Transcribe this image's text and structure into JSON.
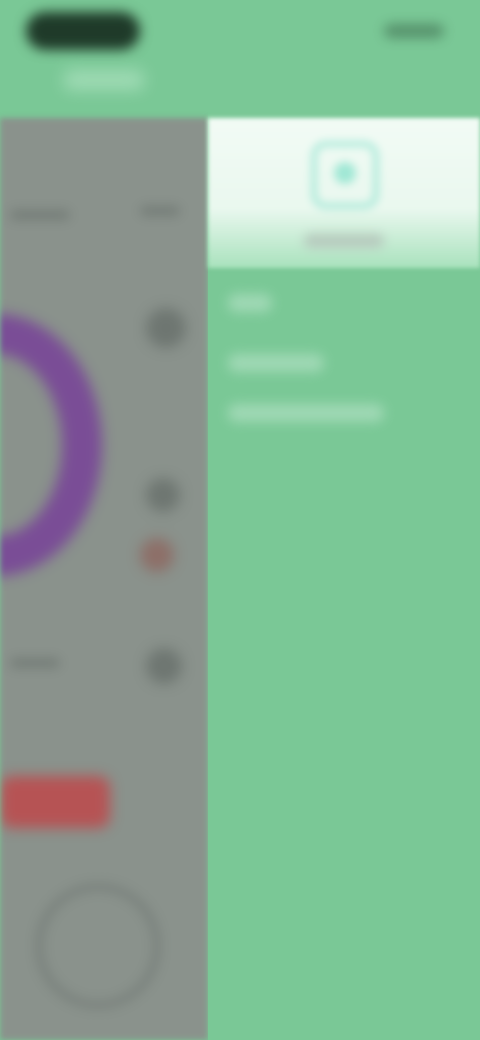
{
  "status_bar": {
    "time": "",
    "indicators": ""
  },
  "drawer": {
    "user_name": "",
    "menu_items": [
      {
        "label": ""
      },
      {
        "label": ""
      },
      {
        "label": ""
      }
    ]
  },
  "colors": {
    "drawer_bg": "#7ac896",
    "background_panel": "#8a928c",
    "progress_ring": "#7a4d96",
    "action_bar": "#b65354",
    "drawer_header": "#f2fbf5"
  }
}
